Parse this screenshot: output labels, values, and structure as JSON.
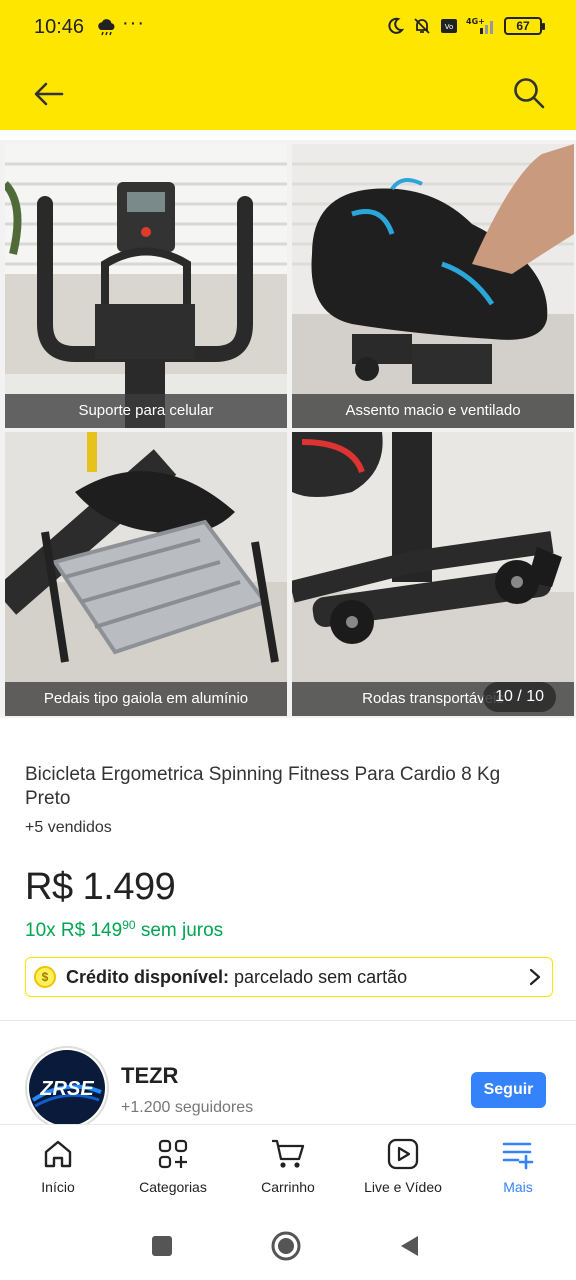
{
  "status_bar": {
    "time": "10:46",
    "dots": "···",
    "battery": "67"
  },
  "gallery": {
    "captions": [
      "Suporte para celular",
      "Assento macio e ventilado",
      "Pedais tipo gaiola em alumínio",
      "Rodas transportáveis"
    ],
    "counter": "10 / 10"
  },
  "product": {
    "title": "Bicicleta Ergometrica Spinning Fitness Para Cardio 8 Kg Preto",
    "sold": "+5 vendidos",
    "price": "R$ 1.499",
    "installments_prefix": "10x R$ 149",
    "installments_cents": "90",
    "installments_suffix": "sem juros",
    "credit_bold": "Crédito disponível:",
    "credit_rest": "parcelado sem cartão",
    "credit_coin": "$"
  },
  "seller": {
    "logo_text": "ZRSE",
    "name": "TEZR",
    "followers": "+1.200 seguidores",
    "follow_label": "Seguir"
  },
  "bottom_nav": {
    "items": [
      {
        "label": "Início",
        "icon": "home-icon"
      },
      {
        "label": "Categorias",
        "icon": "categories-icon"
      },
      {
        "label": "Carrinho",
        "icon": "cart-icon"
      },
      {
        "label": "Live e Vídeo",
        "icon": "play-icon"
      },
      {
        "label": "Mais",
        "icon": "menu-plus-icon"
      }
    ]
  },
  "colors": {
    "brand_yellow": "#ffe600",
    "accent_blue": "#3483fa",
    "green": "#00a650"
  }
}
